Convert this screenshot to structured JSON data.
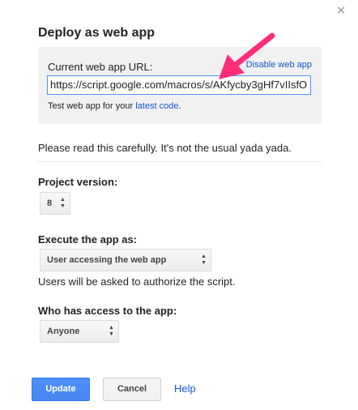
{
  "dialog": {
    "title": "Deploy as web app",
    "close_label": "×"
  },
  "url_panel": {
    "label": "Current web app URL:",
    "disable_link": "Disable web app",
    "url_value": "https://script.google.com/macros/s/AKfycby3gHf7vIIsfO",
    "test_prefix": "Test web app for your ",
    "test_link": "latest code",
    "test_suffix": "."
  },
  "notice": "Please read this carefully. It's not the usual yada yada.",
  "project_version": {
    "label": "Project version:",
    "value": "8"
  },
  "execute_as": {
    "label": "Execute the app as:",
    "value": "User accessing the web app",
    "helper": "Users will be asked to authorize the script."
  },
  "access": {
    "label": "Who has access to the app:",
    "value": "Anyone"
  },
  "buttons": {
    "update": "Update",
    "cancel": "Cancel",
    "help": "Help"
  },
  "colors": {
    "primary_button": "#4d90fe",
    "link": "#1155cc",
    "panel_background": "#f1f1f1",
    "annotation_arrow": "#ff2d78"
  },
  "icons": {
    "close": "close-icon",
    "select_arrows": "up-down-arrows-icon",
    "annotation": "pink-arrow-icon"
  }
}
